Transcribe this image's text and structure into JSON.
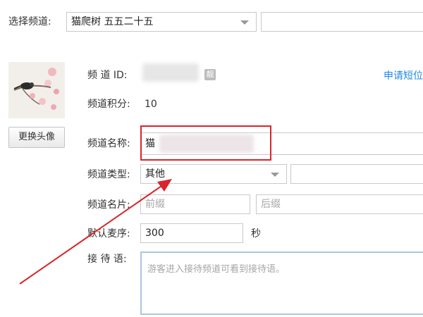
{
  "channel_select": {
    "label": "选择频道:",
    "value": "猫爬树 五五二十五"
  },
  "profile": {
    "change_avatar_label": "更换头像",
    "channel_id_label": "频 道 ID:",
    "copy_icon_glyph": "靓",
    "apply_link": "申请短位",
    "points_label": "频道积分:",
    "points_value": "10"
  },
  "form": {
    "name_label": "频道名称:",
    "name_value": "猫",
    "type_label": "频道类型:",
    "type_value": "其他",
    "card_label": "频道名片:",
    "card_prefix_placeholder": "前缀",
    "card_suffix_placeholder": "后缀",
    "mic_order_label": "默认麦序:",
    "mic_order_value": "300",
    "mic_order_unit": "秒",
    "greeting_label": "接 待 语:",
    "greeting_placeholder": "游客进入接待频道可看到接待语。"
  },
  "annotation": {
    "highlight_color": "#d9252b",
    "arrow_color": "#d9252b"
  }
}
